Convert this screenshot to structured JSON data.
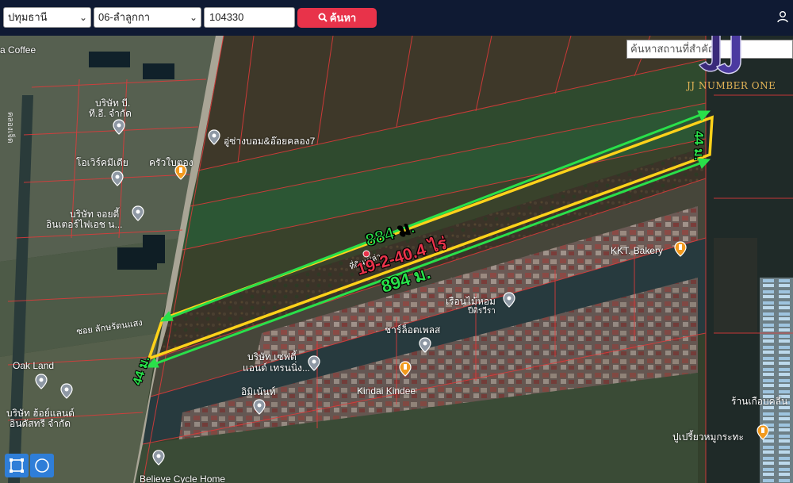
{
  "topbar": {
    "province": "ปทุมธานี",
    "district": "06-ลำลูกกา",
    "search_value": "104330",
    "search_button": "ค้นหา"
  },
  "place_search": {
    "placeholder": "ค้นหาสถานที่สำคัญ"
  },
  "logo": {
    "text": "JJ NUMBER ONE"
  },
  "measurements": {
    "top_length": "884 ม.",
    "bottom_length": "894 ม.",
    "right_width": "44 ม.",
    "left_width": "44 ม.",
    "area": "19-2-40.4 ไร่"
  },
  "places": {
    "coffee": "a Coffee",
    "company_bo": "บริษัท บี.",
    "company_bo2": "ที.อี. จำกัด",
    "media": "โอเวิร์คมีเดีย",
    "kitchen": "ครัวใบตอง",
    "garage": "อู่ซ่างบอม&อ๊อยคลอง7",
    "company_jd": "บริษัท จอยดี้",
    "company_jd2": "อินเตอร์ไฟเอช น...",
    "kkt": "KKT. Bakery",
    "home": "เรือนไม้หอม",
    "home2": "ปีติรวีรา",
    "charlotte": "ชาร์ล็อตเพลส",
    "soi": "ซอย ลักษรัตนแสง",
    "oak": "Oak Land",
    "company_safe": "บริษัท เซฟตี้",
    "company_safe2": "แอนด์ เทรนนิ่ง...",
    "kindai": "Kindai Kindee",
    "imin": "อิมิเน้นท์",
    "company_oak": "บริษัท ฮ้อย์แลนด์",
    "company_oak2": "อินดัสทรี จำกัด",
    "shop": "ร้านเกือบคลีน",
    "pu": "ปูเปรี้ยวหมูกระทะ",
    "cycle": "Believe Cycle Home",
    "canal": "คลองเจ็ด",
    "parcel_label": "ที่ดินเปล่า"
  }
}
